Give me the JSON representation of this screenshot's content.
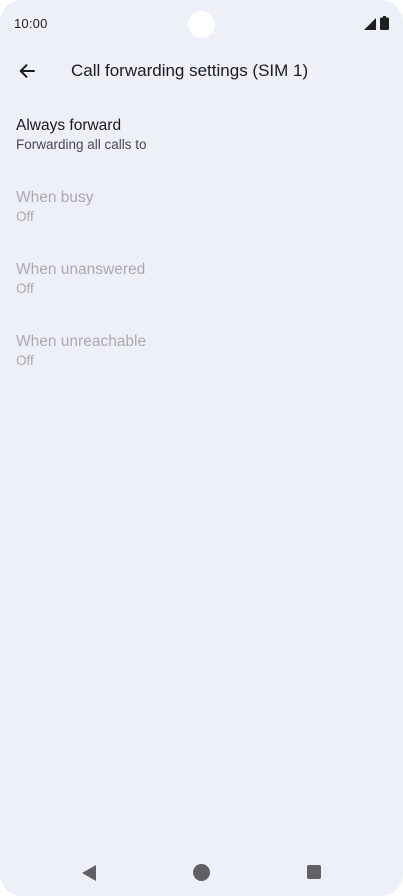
{
  "status_bar": {
    "time": "10:00"
  },
  "app_bar": {
    "title": "Call forwarding settings (SIM 1)",
    "back_icon": "arrow-back-icon"
  },
  "settings": {
    "items": [
      {
        "title": "Always forward",
        "summary": "Forwarding all calls to",
        "enabled": true
      },
      {
        "title": "When busy",
        "summary": "Off",
        "enabled": false
      },
      {
        "title": "When unanswered",
        "summary": "Off",
        "enabled": false
      },
      {
        "title": "When unreachable",
        "summary": "Off",
        "enabled": false
      }
    ]
  },
  "navigation_bar": {
    "icons": [
      "nav-back-icon",
      "nav-home-icon",
      "nav-recents-icon"
    ]
  },
  "colors": {
    "background": "#eef0f8",
    "text_primary": "#1b1b1f",
    "text_secondary": "#45464f",
    "text_disabled": "#a9aab0",
    "nav_icon": "#5f6066"
  }
}
